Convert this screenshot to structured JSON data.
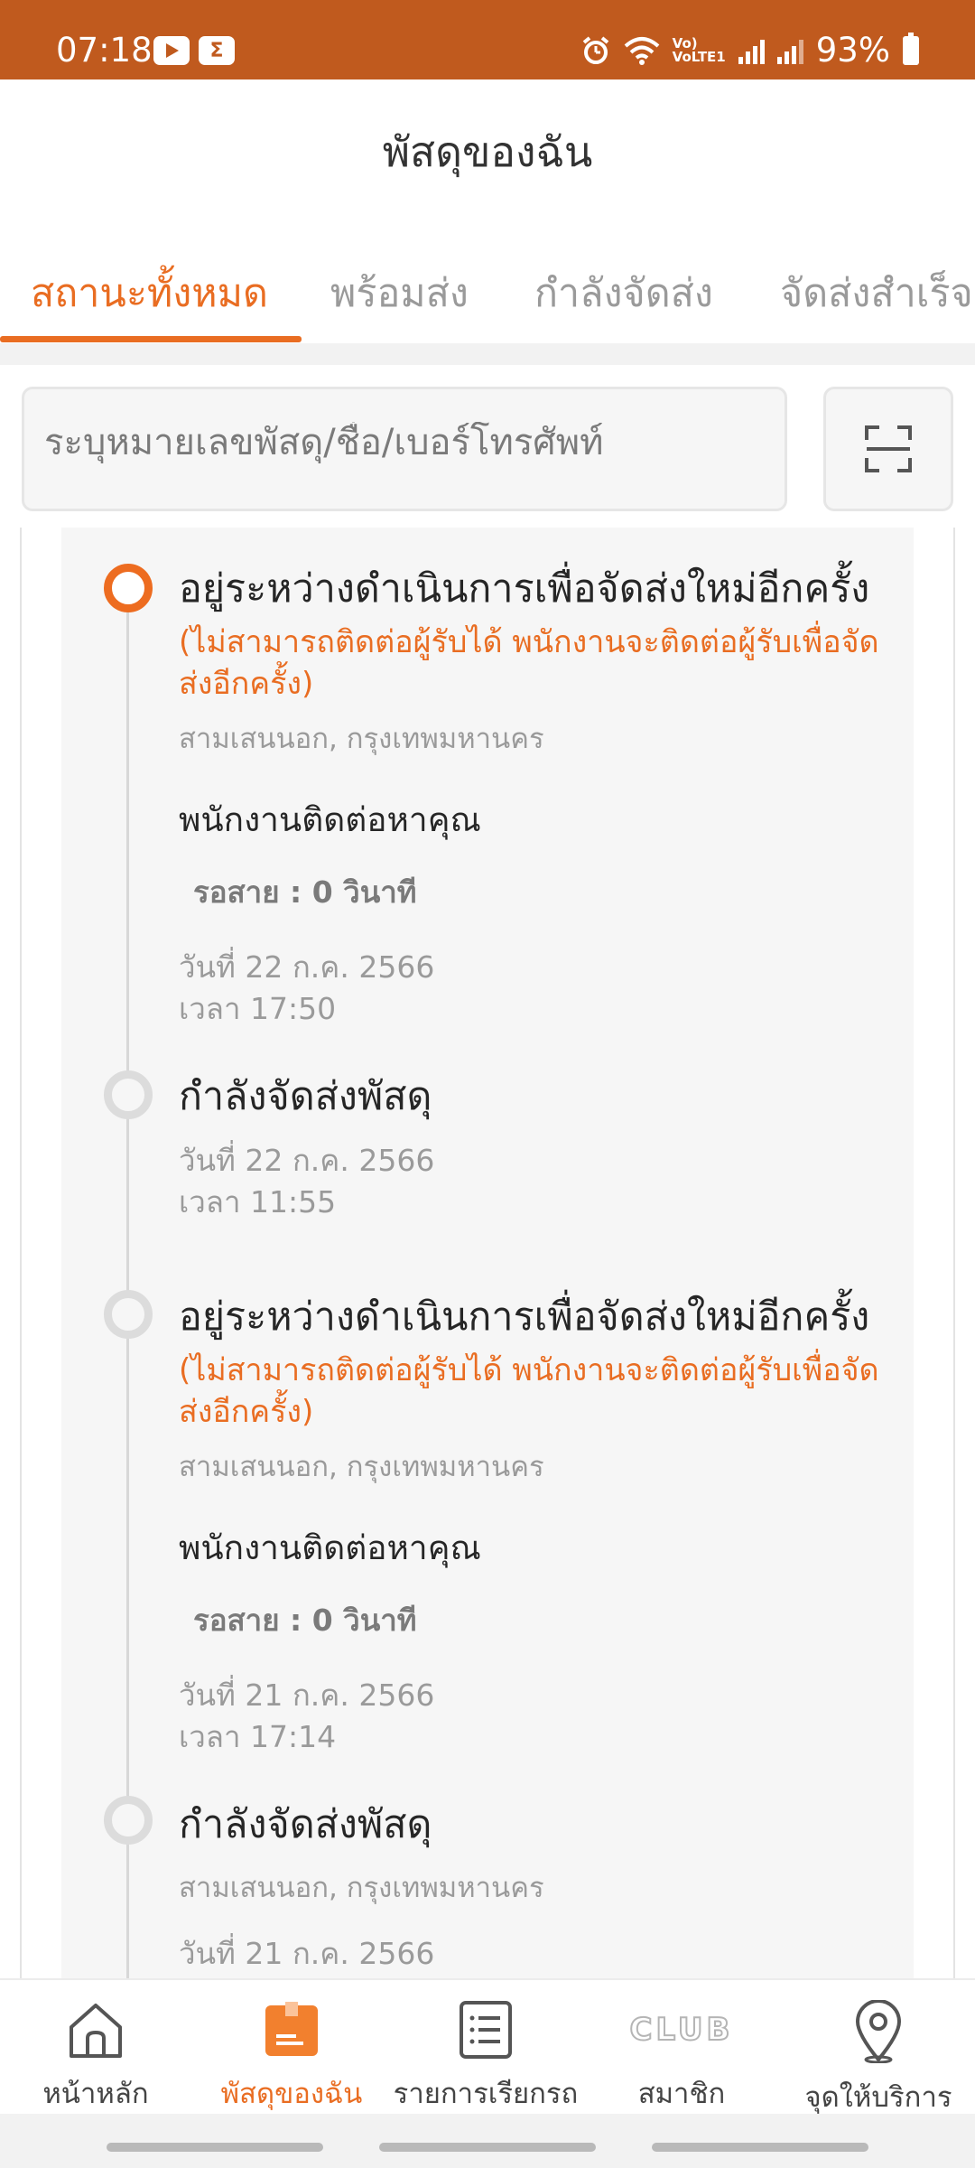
{
  "status_bar": {
    "time": "07:18",
    "app_icons": [
      "youtube-icon",
      "sigma-icon"
    ],
    "battery": "93%",
    "network_label": "VoLTE1"
  },
  "header": {
    "title": "พัสดุของฉัน"
  },
  "tabs": [
    {
      "label": "สถานะทั้งหมด",
      "active": true
    },
    {
      "label": "พร้อมส่ง",
      "active": false
    },
    {
      "label": "กำลังจัดส่ง",
      "active": false
    },
    {
      "label": "จัดส่งสำเร็จ",
      "active": false
    }
  ],
  "search": {
    "placeholder": "ระบุหมายเลขพัสดุ/ชื่อ/เบอร์โทรศัพท์",
    "value": ""
  },
  "timeline": [
    {
      "title": "อยู่ระหว่างดำเนินการเพื่อจัดส่งใหม่อีกครั้ง",
      "note": "(ไม่สามารถติดต่อผู้รับได้ พนักงานจะติดต่อผู้รับเพื่อจัดส่งอีกครั้ง)",
      "location": "สามเสนนอก, กรุงเทพมหานคร",
      "contact": "พนักงานติดต่อหาคุณ",
      "wait": "รอสาย : 0 วินาที",
      "date": "วันที่ 22 ก.ค. 2566",
      "time": "เวลา 17:50",
      "active": true
    },
    {
      "title": "กำลังจัดส่งพัสดุ",
      "date": "วันที่ 22 ก.ค. 2566",
      "time": "เวลา 11:55",
      "active": false
    },
    {
      "title": "อยู่ระหว่างดำเนินการเพื่อจัดส่งใหม่อีกครั้ง",
      "note": "(ไม่สามารถติดต่อผู้รับได้ พนักงานจะติดต่อผู้รับเพื่อจัดส่งอีกครั้ง)",
      "location": "สามเสนนอก, กรุงเทพมหานคร",
      "contact": "พนักงานติดต่อหาคุณ",
      "wait": "รอสาย : 0 วินาที",
      "date": "วันที่ 21 ก.ค. 2566",
      "time": "เวลา 17:14",
      "active": false
    },
    {
      "title": "กำลังจัดส่งพัสดุ",
      "location": "สามเสนนอก, กรุงเทพมหานคร",
      "date": "วันที่ 21 ก.ค. 2566",
      "active": false
    }
  ],
  "bottom_nav": [
    {
      "label": "หน้าหลัก",
      "icon": "home-icon",
      "active": false
    },
    {
      "label": "พัสดุของฉัน",
      "icon": "parcel-icon",
      "active": true
    },
    {
      "label": "รายการเรียกรถ",
      "icon": "list-icon",
      "active": false
    },
    {
      "label": "สมาชิก",
      "icon": "club-icon",
      "icon_text": "CLUB",
      "active": false
    },
    {
      "label": "จุดให้บริการ",
      "icon": "location-pin-icon",
      "active": false
    }
  ],
  "colors": {
    "accent": "#e96d22",
    "status_bar": "#c05a1e"
  }
}
